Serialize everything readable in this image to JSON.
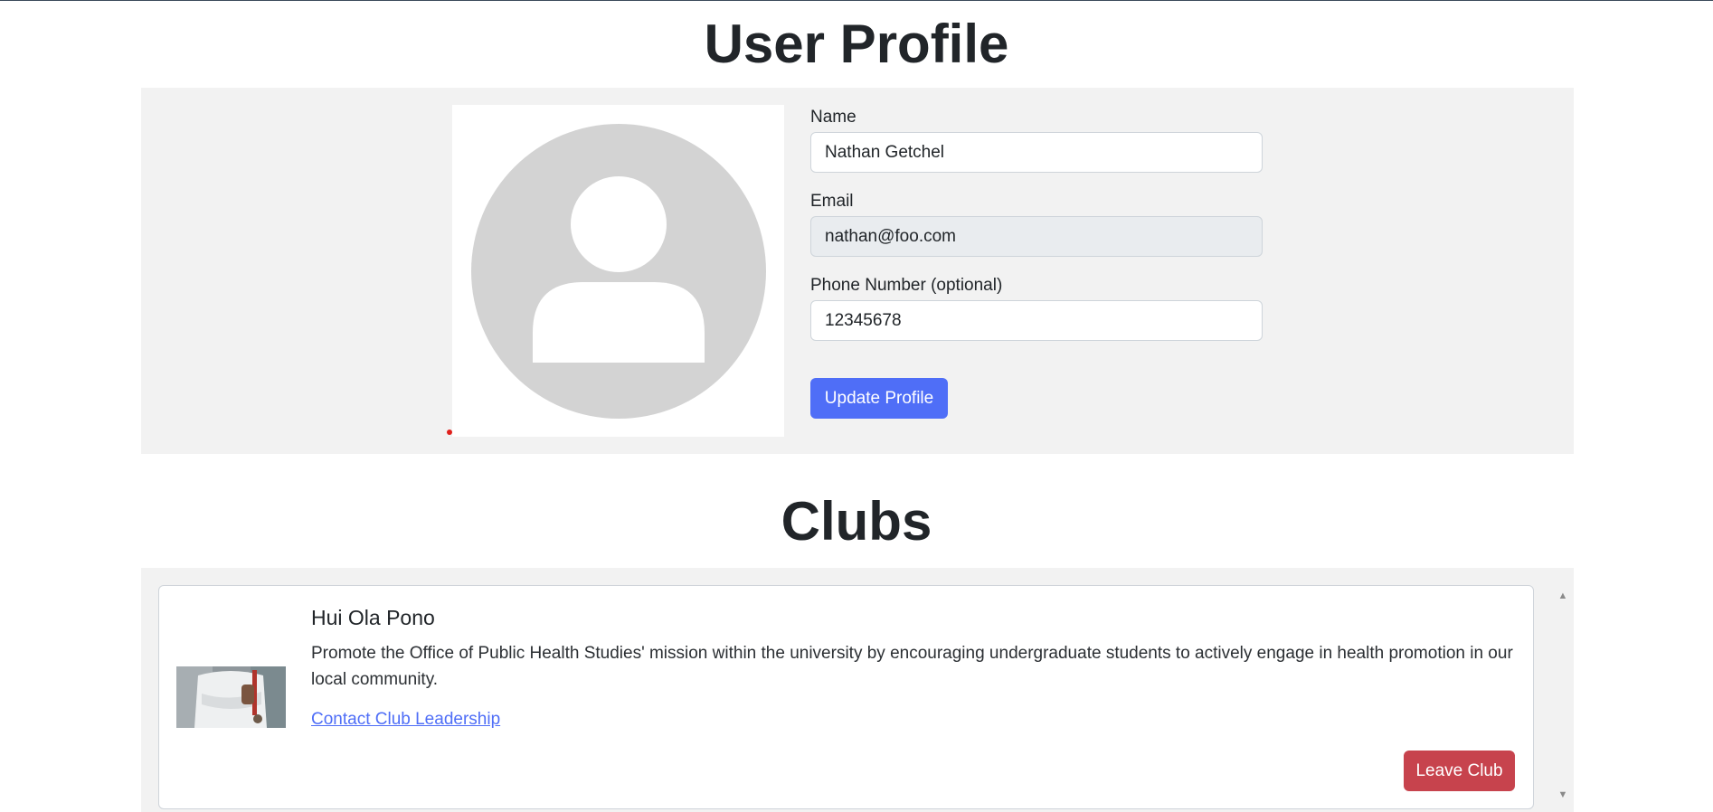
{
  "page": {
    "title": "User Profile"
  },
  "profile": {
    "avatar_icon": "user-avatar-icon",
    "fields": {
      "name": {
        "label": "Name",
        "value": "Nathan Getchel"
      },
      "email": {
        "label": "Email",
        "value": "nathan@foo.com"
      },
      "phone": {
        "label": "Phone Number (optional)",
        "value": "12345678"
      }
    },
    "update_button": "Update Profile"
  },
  "clubs": {
    "title": "Clubs",
    "items": [
      {
        "name": "Hui Ola Pono",
        "description": "Promote the Office of Public Health Studies' mission within the university by encouraging undergraduate students to actively engage in health promotion in our local community.",
        "contact_link": "Contact Club Leadership",
        "leave_button": "Leave Club"
      }
    ]
  },
  "colors": {
    "primary": "#4f6ef7",
    "danger": "#c7434d",
    "panel": "#f2f2f2",
    "avatar_gray": "#d3d3d3"
  }
}
